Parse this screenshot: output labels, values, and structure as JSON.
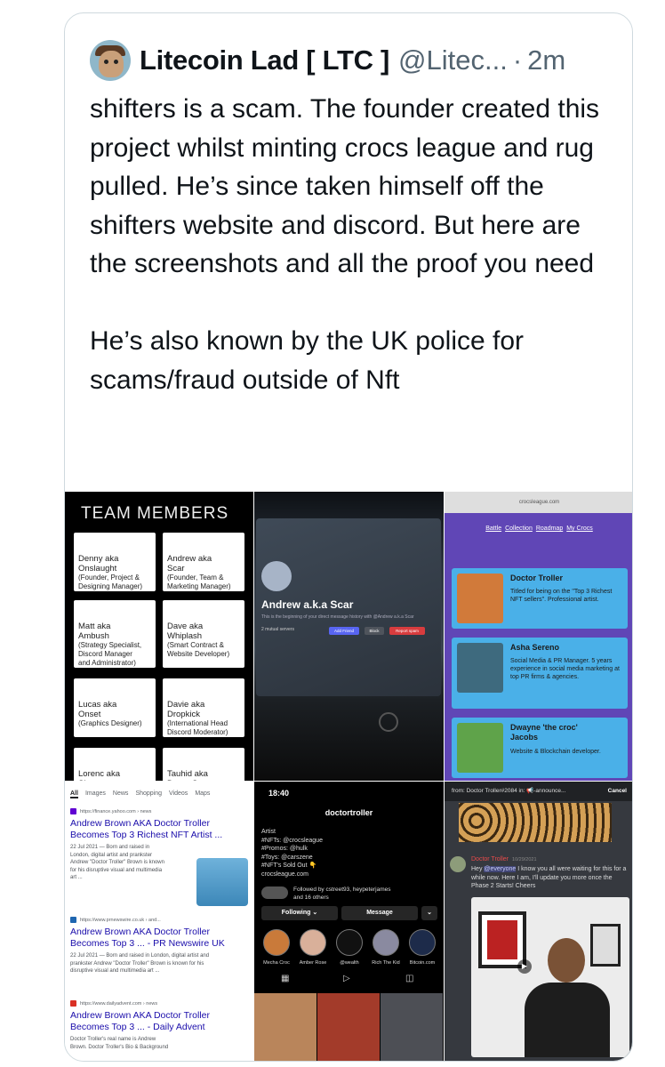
{
  "tweet": {
    "display_name": "Litecoin Lad [ LTC ]",
    "handle": "@Litec...",
    "separator": "·",
    "time": "2m",
    "text": "shifters is a scam. The founder created this project whilst minting crocs league and rug pulled. He’s since taken himself off the shifters website and discord. But here are the screenshots and all the proof you need\n\nHe’s also known by the UK police for scams/fraud outside of Nft"
  },
  "media": {
    "team": {
      "title": "TEAM MEMBERS",
      "members": [
        {
          "name": "Denny aka\nOnslaught",
          "role": "(Founder, Project &\nDesigning Manager)"
        },
        {
          "name": "Andrew aka\nScar",
          "role": "(Founder, Team &\nMarketing Manager)"
        },
        {
          "name": "Matt aka\nAmbush",
          "role": "(Strategy Specialist,\nDiscord Manager\nand Administrator)"
        },
        {
          "name": "Dave aka\nWhiplash",
          "role": "(Smart Contract &\nWebsite Developer)"
        },
        {
          "name": "Lucas aka\nOnset",
          "role": "(Graphics Designer)"
        },
        {
          "name": "Davie aka\nDropkick",
          "role": "(International Head\nDiscord Moderator)"
        },
        {
          "name": "Lorenc aka\nShatter",
          "role": ""
        },
        {
          "name": "Tauhid aka\nDesertStorm",
          "role": ""
        }
      ]
    },
    "discord_dm": {
      "name": "Andrew a.k.a Scar",
      "subtitle": "This is the beginning of your direct message history with @Andrew a.k.a Scar",
      "mutual": "2 mutual servers",
      "add_friend": "Add Friend",
      "block": "Block",
      "report": "Report spam"
    },
    "crocs": {
      "url": "crocsleague.com",
      "nav": [
        "Battle",
        "Collection",
        "Roadmap",
        "My Crocs"
      ],
      "cards": [
        {
          "name": "Doctor Troller",
          "desc": "Titled for being on the \"Top 3 Richest NFT sellers\". Professional artist."
        },
        {
          "name": "Asha Sereno",
          "desc": "Social Media & PR Manager. 5 years experience in social media marketing at top PR firms & agencies."
        },
        {
          "name": "Dwayne 'the croc'\nJacobs",
          "desc": "Website & Blockchain developer."
        }
      ]
    },
    "google": {
      "tabs": [
        "All",
        "Images",
        "News",
        "Shopping",
        "Videos",
        "Maps"
      ],
      "results": [
        {
          "url": "https://finance.yahoo.com › news",
          "title": "Andrew Brown AKA Doctor Troller\nBecomes Top 3 Richest NFT Artist ...",
          "snippet": "22 Jul 2021 — Born and raised in\nLondon, digital artist and prankster\nAndrew \"Doctor Troller\" Brown is known\nfor his disruptive visual and multimedia\nart ..."
        },
        {
          "url": "https://www.prnewswire.co.uk › and...",
          "title": "Andrew Brown AKA Doctor Troller\nBecomes Top 3 ... - PR Newswire UK",
          "snippet": "22 Jul 2021 — Born and raised in London, digital artist and\nprankster Andrew \"Doctor Troller\" Brown is known for his\ndisruptive visual and multimedia art ..."
        },
        {
          "url": "https://www.dailyadvent.com › news",
          "title": "Andrew Brown AKA Doctor Troller\nBecomes Top 3 ... - Daily Advent",
          "snippet": "Doctor Troller's real name is Andrew\nBrown. Doctor Troller's Bio & Background"
        }
      ]
    },
    "instagram": {
      "time": "18:40",
      "username": "doctortroller",
      "bio": "Artist\n#NFTs: @crocsleague\n#Promos: @hulk\n#Toys: @carszene\n#NFT's Sold Out 👇\ncrocsleague.com",
      "followed_by": "Followed by cstreet93, heypeterjames\nand 16 others",
      "following": "Following ⌄",
      "message": "Message",
      "highlights": [
        "Mecha Croc",
        "Amber Rose",
        "@wealth",
        "Rich The Kid",
        "Bitcoin.com"
      ]
    },
    "announcement": {
      "top_bar": "from: Doctor Troller#2084 in: 📢-announce...",
      "cancel": "Cancel",
      "author": "Doctor Troller",
      "date": "10/29/2021",
      "mention": "@everyone",
      "message": " I know you all were waiting for this for a while now. Here I am, I'll update you more once the Phase 2 Starts! Cheers"
    }
  },
  "colors": {
    "text": "#0f1419",
    "secondary": "#536471",
    "border": "#cfd9de",
    "crocs_bg": "#6046b6",
    "crocs_card": "#4ab0e8",
    "google_link": "#1a0dab"
  }
}
